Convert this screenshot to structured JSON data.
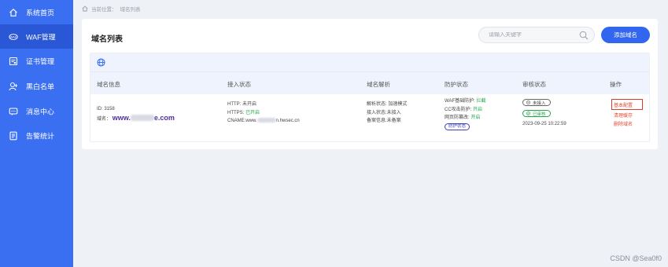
{
  "sidebar": {
    "items": [
      {
        "label": "系统首页",
        "icon": "home-icon"
      },
      {
        "label": "WAF管理",
        "icon": "waf-icon"
      },
      {
        "label": "证书管理",
        "icon": "certificate-icon"
      },
      {
        "label": "黑白名单",
        "icon": "user-list-icon"
      },
      {
        "label": "消息中心",
        "icon": "message-icon"
      },
      {
        "label": "告警统计",
        "icon": "report-icon"
      }
    ],
    "active_index": 1
  },
  "breadcrumb": {
    "prefix": "当前位置：",
    "current": "域名列表"
  },
  "panel": {
    "title": "域名列表",
    "search_placeholder": "请输入关键字",
    "add_button": "添加域名"
  },
  "table": {
    "headers": [
      "域名信息",
      "接入状态",
      "域名解析",
      "防护状态",
      "审核状态",
      "操作"
    ],
    "row": {
      "id_label": "ID: 3158",
      "domain_label": "域名：",
      "domain_prefix": "www.",
      "domain_suffix": "e.com",
      "http_label": "HTTP: 未开启",
      "https_label": "HTTPS: ",
      "https_value": "已开启",
      "cname_prefix": "CNAME:www.",
      "cname_suffix": "n.hwsec.cn",
      "resolve_status": "解析状态: 加速模式",
      "access_status": "接入状态:未接入",
      "record_info": "备案信息:未备案",
      "waf_label": "WAF基础防护: ",
      "waf_value": "拦截",
      "cc_label": "CC攻击防护: ",
      "cc_value": "开启",
      "anti_tamper_label": "网页防篡改: ",
      "anti_tamper_value": "开启",
      "protect_status_tag": "防护状态",
      "review_not_connected": "未接入",
      "review_approved": "已审核",
      "review_time": "2023-09-25 10:22:59",
      "ops": [
        "基本配置",
        "清理缓存",
        "删除域名"
      ]
    }
  },
  "watermark": "CSDN @Sea0f0",
  "colors": {
    "sidebar": "#3b6ff2",
    "sidebar_active": "#2a57d6",
    "primary_button": "#3366ee",
    "success": "#21a648",
    "danger": "#e24b33"
  }
}
